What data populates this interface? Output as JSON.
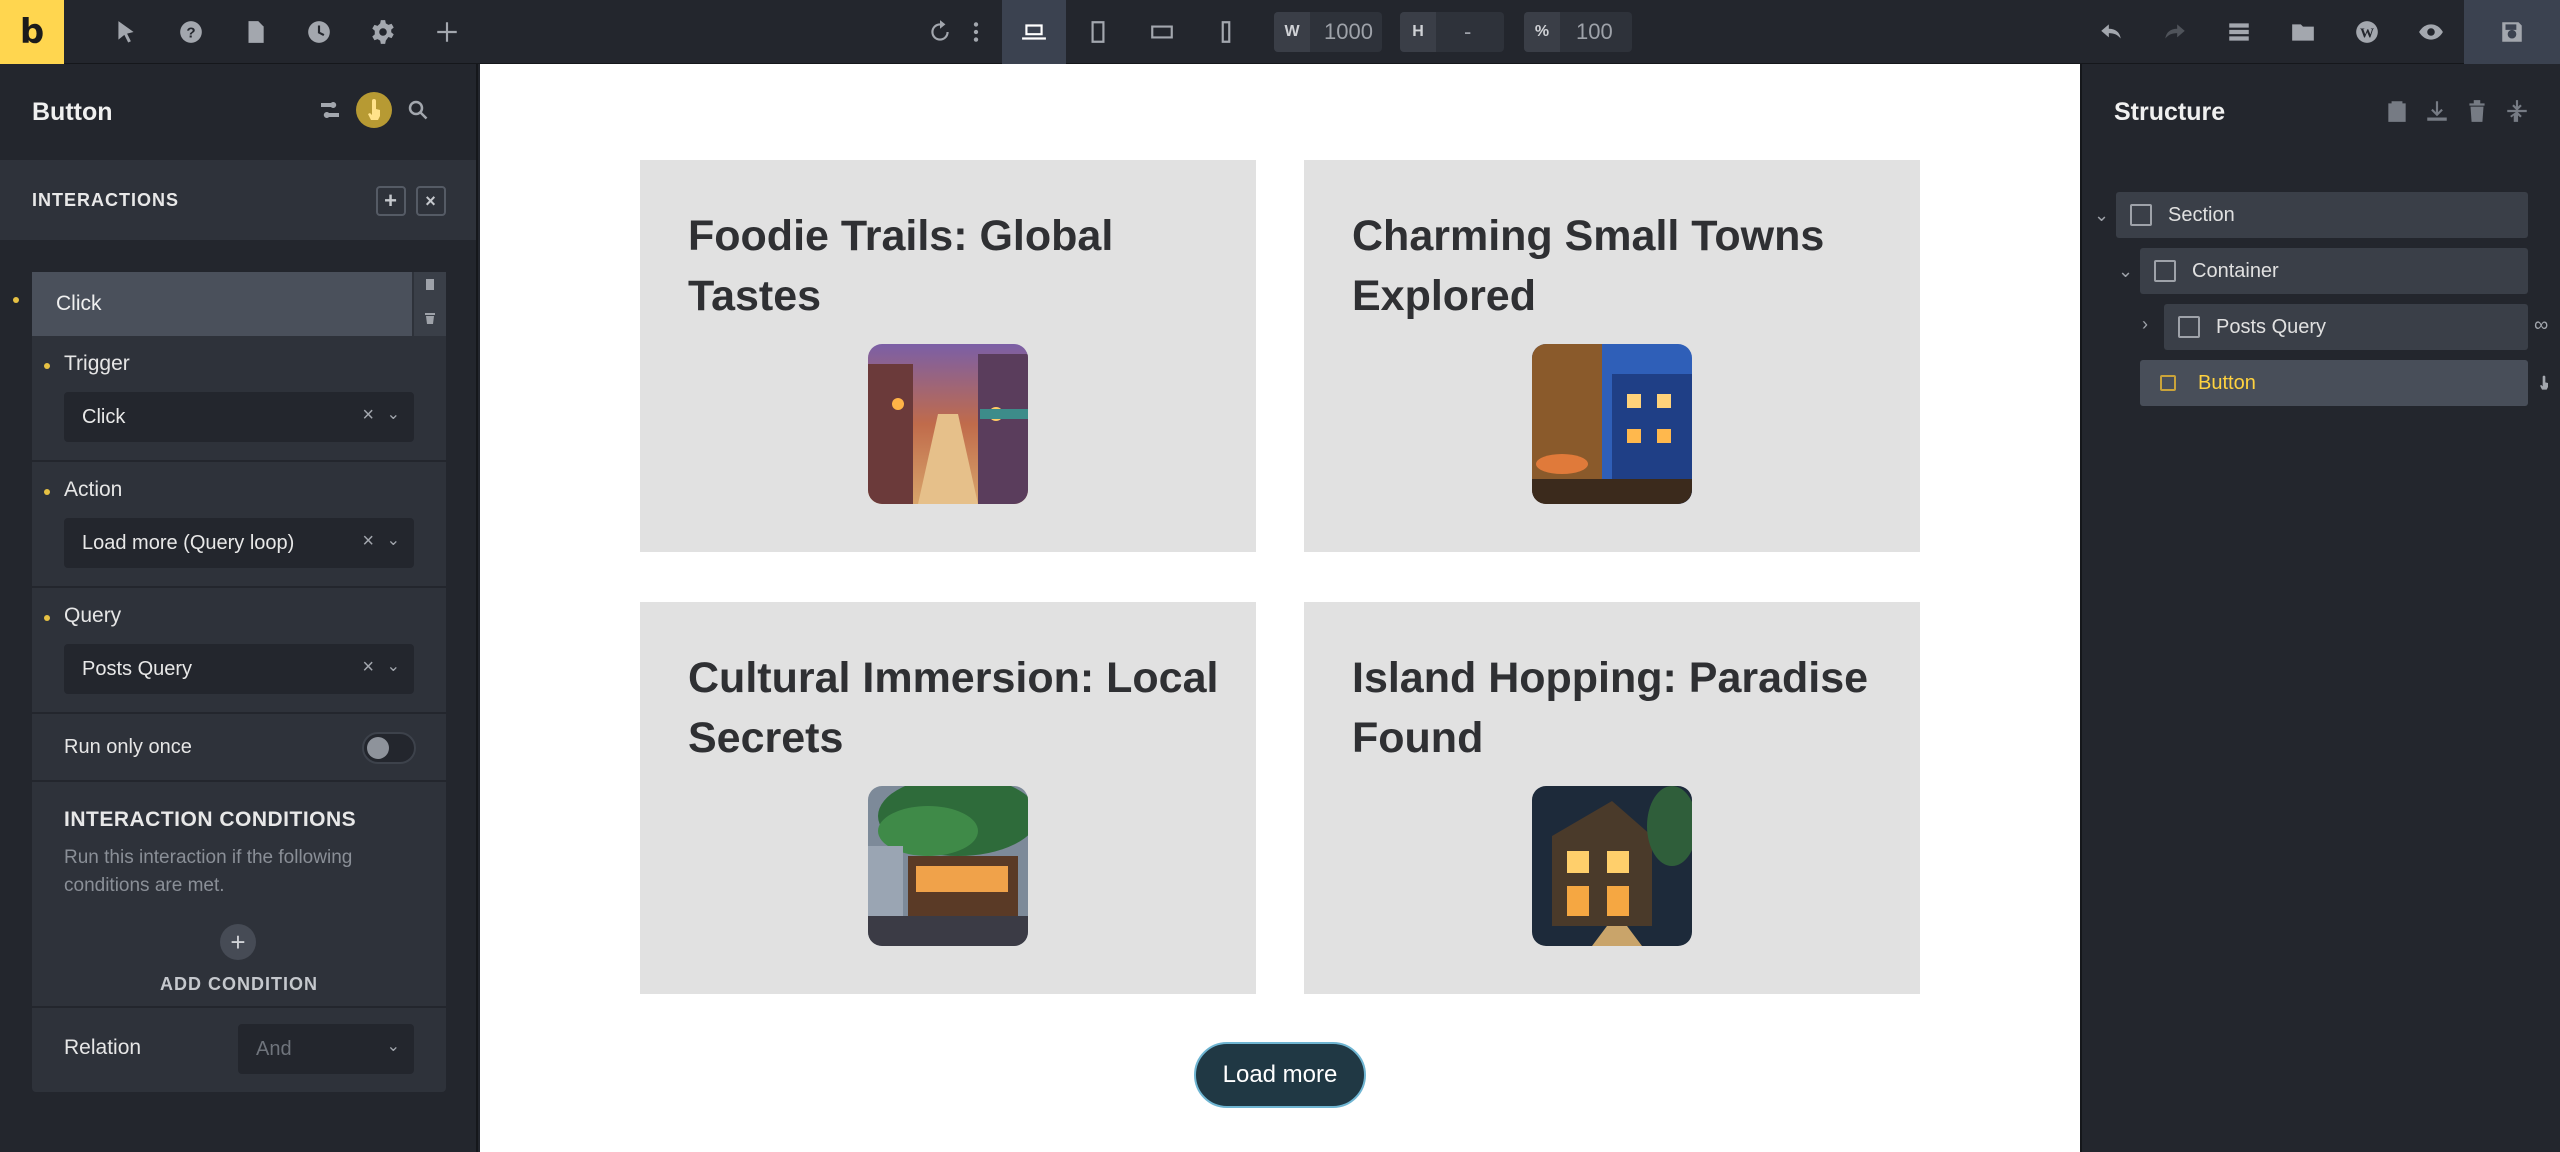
{
  "toolbar": {
    "logo": "b",
    "width_label": "W",
    "width_value": "1000",
    "height_label": "H",
    "height_value": "-",
    "scale_label": "%",
    "scale_value": "100"
  },
  "left_panel": {
    "title": "Button",
    "section_title": "INTERACTIONS",
    "interaction_name": "Click",
    "trigger_label": "Trigger",
    "trigger_value": "Click",
    "action_label": "Action",
    "action_value": "Load more (Query loop)",
    "query_label": "Query",
    "query_value": "Posts Query",
    "run_once_label": "Run only once",
    "conditions_title": "INTERACTION CONDITIONS",
    "conditions_desc": "Run this interaction if the following conditions are met.",
    "add_condition_label": "ADD CONDITION",
    "relation_label": "Relation",
    "relation_value": "And"
  },
  "canvas": {
    "posts": [
      {
        "title": "Foodie Trails: Global Tastes"
      },
      {
        "title": "Charming Small Towns Explored"
      },
      {
        "title": "Cultural Immersion: Local Secrets"
      },
      {
        "title": "Island Hopping: Paradise Found"
      }
    ],
    "load_more_label": "Load more"
  },
  "structure": {
    "title": "Structure",
    "items": [
      {
        "label": "Section"
      },
      {
        "label": "Container"
      },
      {
        "label": "Posts Query"
      },
      {
        "label": "Button"
      }
    ]
  }
}
